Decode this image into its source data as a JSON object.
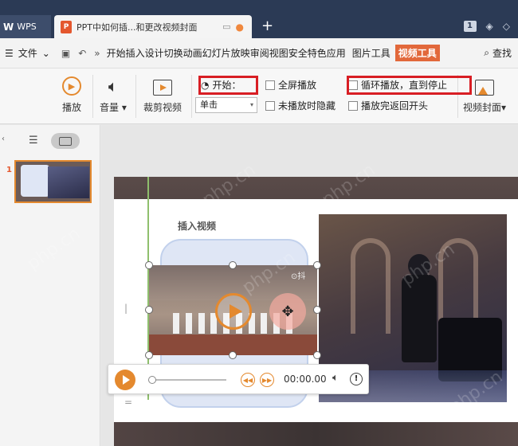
{
  "titlebar": {
    "app_tab": "WPS",
    "doc_tab_title": "PPT中如何插...和更改视频封面",
    "new_tab": "+",
    "badge": "1"
  },
  "menubar": {
    "file": "文件",
    "items": [
      "开始",
      "插入",
      "设计",
      "切换",
      "动画",
      "幻灯片放映",
      "审阅",
      "视图",
      "安全",
      "特色应用",
      "图片工具",
      "视频工具"
    ],
    "search": "查找"
  },
  "ribbon": {
    "play": "播放",
    "volume": "音量",
    "trim": "裁剪视频",
    "start_label": "开始：",
    "start_value": "单击",
    "fullscreen": "全屏播放",
    "hide_when_not_playing": "未播放时隐藏",
    "loop": "循环播放，直到停止",
    "rewind_after": "播放完返回开头",
    "cover": "视频封面"
  },
  "slides": {
    "current_number": "1"
  },
  "slide": {
    "insert_title": "插入视频",
    "video_brand": "⊙抖"
  },
  "player": {
    "time": "00:00.00",
    "progress": 0
  },
  "watermark": "php.cn",
  "colors": {
    "accent": "#e4892e",
    "active_tab": "#e2683b",
    "highlight_box": "#d81e24"
  }
}
